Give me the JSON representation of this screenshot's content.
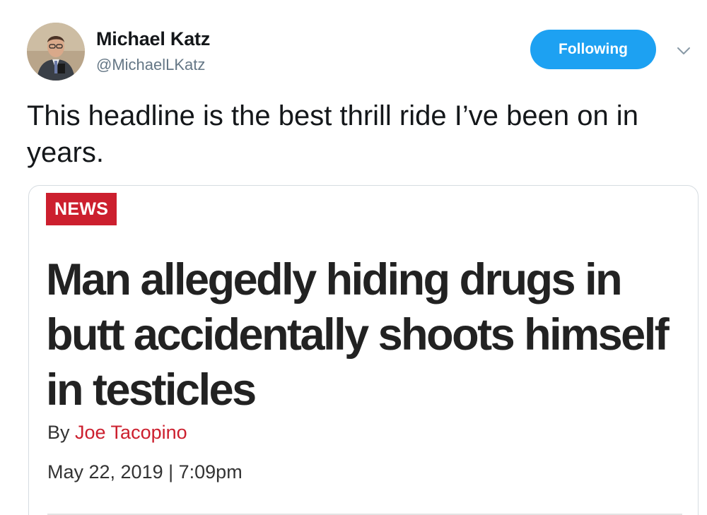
{
  "user": {
    "display_name": "Michael Katz",
    "handle": "@MichaelLKatz",
    "follow_label": "Following"
  },
  "tweet": {
    "text": "This headline is the best thrill ride I’ve been on in years."
  },
  "article": {
    "section_badge": "NEWS",
    "headline": "Man allegedly hiding drugs in butt accidentally shoots himself in testicles",
    "byline_prefix": "By ",
    "author": "Joe Tacopino",
    "date": "May 22, 2019 | 7:09pm"
  },
  "colors": {
    "follow_button": "#1da1f2",
    "news_badge": "#cc1f2e",
    "author_link": "#cc1f2e"
  },
  "icons": {
    "avatar": "profile-photo",
    "caret": "chevron-down-icon"
  }
}
